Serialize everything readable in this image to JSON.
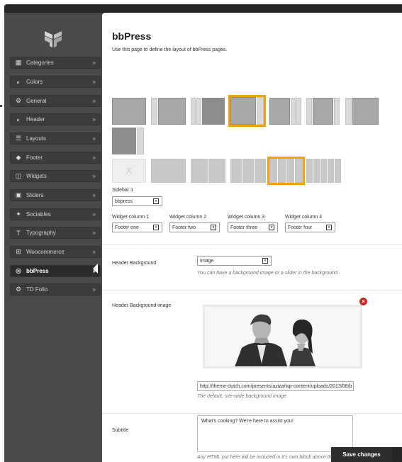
{
  "sidebar": {
    "items": [
      {
        "label": "Categories",
        "icon": "grid-icon"
      },
      {
        "label": "Colors",
        "icon": "contrast-icon"
      },
      {
        "label": "General",
        "icon": "cogs-icon"
      },
      {
        "label": "Header",
        "icon": "contrast-icon"
      },
      {
        "label": "Layouts",
        "icon": "list-icon"
      },
      {
        "label": "Footer",
        "icon": "tag-icon"
      },
      {
        "label": "Widgets",
        "icon": "columns-icon"
      },
      {
        "label": "Sliders",
        "icon": "image-icon"
      },
      {
        "label": "Sociables",
        "icon": "twitter-icon"
      },
      {
        "label": "Typography",
        "icon": "text-icon"
      },
      {
        "label": "Woocommerce",
        "icon": "cart-icon"
      },
      {
        "label": "bbPress",
        "icon": "bbpress-icon"
      },
      {
        "label": "TD Folio",
        "icon": "cogs-icon"
      }
    ],
    "active": "bbPress"
  },
  "main": {
    "title": "bbPress",
    "description": "Use this page to define the layout of bbPress pages.",
    "sidebar1": {
      "label": "Sidebar 1",
      "value": "bbpress"
    },
    "widget_columns": [
      {
        "label": "Widget column 1",
        "value": "Footer one"
      },
      {
        "label": "Widget column 2",
        "value": "Footer two"
      },
      {
        "label": "Widget column 3",
        "value": "Footer three"
      },
      {
        "label": "Widget column 4",
        "value": "Footer four"
      }
    ],
    "header_background": {
      "label": "Header Background",
      "value": "Image",
      "help": "You can have a background image or a slider in the background."
    },
    "header_background_image": {
      "label": "Header Background image",
      "url": "http://theme-dutch.com/presents/aziza/wp-content/uploads/2013/08/b",
      "help": "The default, site-wide background image."
    },
    "subtitle": {
      "label": "Subtitle",
      "value": "What's cooking? We're here to assist you!",
      "help": "Any HTML put here will be included in it's own block above the"
    },
    "empty_layout_glyph": "X",
    "save_label": "Save changes"
  },
  "colors": {
    "accent": "#f2a20a",
    "sidebar_bg": "#4a4a4a",
    "frame_bg": "#262626",
    "close_red": "#cc2a22"
  }
}
